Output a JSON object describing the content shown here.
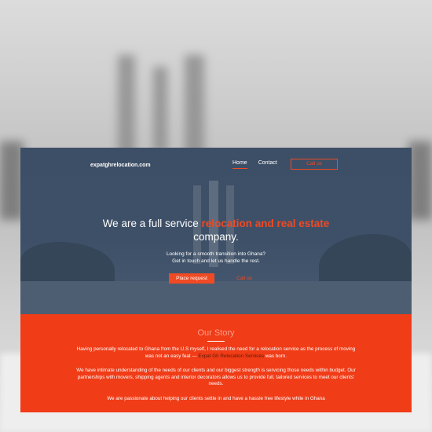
{
  "header": {
    "logo": "expatghrelocation.com",
    "nav": [
      {
        "label": "Home",
        "active": true
      },
      {
        "label": "Contact",
        "active": false
      }
    ],
    "cta": "Call us"
  },
  "hero": {
    "headline_pre": "We are a full service ",
    "headline_accent": "relocation and real estate",
    "headline_post": "company.",
    "sub_line1": "Looking for a smooth transition into Ghana?",
    "sub_line2": "Get in touch and let us handle the rest.",
    "primary_button": "Place request",
    "secondary_button": "Call us"
  },
  "story": {
    "title": "Our Story",
    "p1_pre": "Having personally relocated to Ghana from the U.S myself, I realised the need for a relocation service as the process of moving was not an easy feat — ",
    "p1_highlight": "Expat Gh Relocation Services",
    "p1_post": " was born.",
    "p2": "We have intimate understanding of the needs of our clients and our biggest strength is servicing those needs within budget. Our partnerships with movers, shipping agents and interior decorators allows us to provide full, tailored services to meet our clients' needs.",
    "p3": "We are passionate about helping our clients settle in and have a hassle free lifestyle while in Ghana"
  },
  "colors": {
    "accent": "#f04a24",
    "hero_overlay": "#3d4f66",
    "story_bg": "#f03c17"
  }
}
